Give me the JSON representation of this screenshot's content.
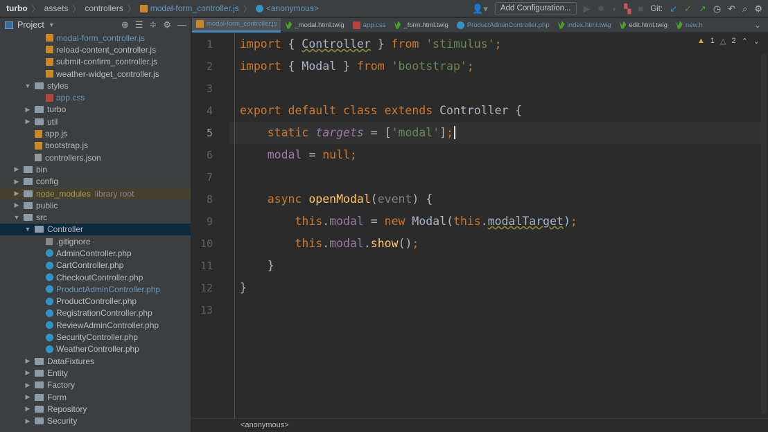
{
  "breadcrumb": [
    "turbo",
    "assets",
    "controllers",
    "modal-form_controller.js",
    "<anonymous>"
  ],
  "toolbar": {
    "add_configuration": "Add Configuration...",
    "git_label": "Git:"
  },
  "sidebar": {
    "title": "Project",
    "items": [
      {
        "label": "modal-form_controller.js",
        "level": 3,
        "type": "js",
        "color": "blue"
      },
      {
        "label": "reload-content_controller.js",
        "level": 3,
        "type": "js"
      },
      {
        "label": "submit-confirm_controller.js",
        "level": 3,
        "type": "js"
      },
      {
        "label": "weather-widget_controller.js",
        "level": 3,
        "type": "js"
      },
      {
        "label": "styles",
        "level": 2,
        "type": "folder",
        "open": true
      },
      {
        "label": "app.css",
        "level": 3,
        "type": "css",
        "color": "blue"
      },
      {
        "label": "turbo",
        "level": 2,
        "type": "folder"
      },
      {
        "label": "util",
        "level": 2,
        "type": "folder"
      },
      {
        "label": "app.js",
        "level": 2,
        "type": "js",
        "leaf": true
      },
      {
        "label": "bootstrap.js",
        "level": 2,
        "type": "js",
        "leaf": true
      },
      {
        "label": "controllers.json",
        "level": 2,
        "type": "json",
        "leaf": true
      },
      {
        "label": "bin",
        "level": 1,
        "type": "folder"
      },
      {
        "label": "config",
        "level": 1,
        "type": "folder"
      },
      {
        "label": "node_modules",
        "level": 1,
        "type": "folder",
        "color": "yel",
        "note": "library root"
      },
      {
        "label": "public",
        "level": 1,
        "type": "folder"
      },
      {
        "label": "src",
        "level": 1,
        "type": "folder",
        "open": true
      },
      {
        "label": "Controller",
        "level": 2,
        "type": "folder",
        "open": true,
        "selected": true
      },
      {
        "label": ".gitignore",
        "level": 3,
        "type": "git"
      },
      {
        "label": "AdminController.php",
        "level": 3,
        "type": "php"
      },
      {
        "label": "CartController.php",
        "level": 3,
        "type": "php"
      },
      {
        "label": "CheckoutController.php",
        "level": 3,
        "type": "php"
      },
      {
        "label": "ProductAdminController.php",
        "level": 3,
        "type": "php",
        "color": "blue"
      },
      {
        "label": "ProductController.php",
        "level": 3,
        "type": "php"
      },
      {
        "label": "RegistrationController.php",
        "level": 3,
        "type": "php"
      },
      {
        "label": "ReviewAdminController.php",
        "level": 3,
        "type": "php"
      },
      {
        "label": "SecurityController.php",
        "level": 3,
        "type": "php"
      },
      {
        "label": "WeatherController.php",
        "level": 3,
        "type": "php"
      },
      {
        "label": "DataFixtures",
        "level": 2,
        "type": "folder"
      },
      {
        "label": "Entity",
        "level": 2,
        "type": "folder"
      },
      {
        "label": "Factory",
        "level": 2,
        "type": "folder"
      },
      {
        "label": "Form",
        "level": 2,
        "type": "folder"
      },
      {
        "label": "Repository",
        "level": 2,
        "type": "folder"
      },
      {
        "label": "Security",
        "level": 2,
        "type": "folder"
      }
    ]
  },
  "tabs": [
    {
      "label": "modal-form_controller.js",
      "type": "js",
      "active": true
    },
    {
      "label": "_modal.html.twig",
      "type": "twig"
    },
    {
      "label": "app.css",
      "type": "css",
      "blue": true
    },
    {
      "label": "_form.html.twig",
      "type": "twig"
    },
    {
      "label": "ProductAdminController.php",
      "type": "php",
      "blue": true
    },
    {
      "label": "index.html.twig",
      "type": "twig",
      "blue": true
    },
    {
      "label": "edit.html.twig",
      "type": "twig"
    },
    {
      "label": "new.h",
      "type": "twig",
      "blue": true
    }
  ],
  "inspections": {
    "warnings": "1",
    "weak_warnings": "2"
  },
  "code": [
    [
      [
        "kw",
        "import "
      ],
      [
        "",
        "{ "
      ],
      [
        "ul",
        "Controller"
      ],
      [
        "",
        " } "
      ],
      [
        "kw",
        "from "
      ],
      [
        "str",
        "'stimulus'"
      ],
      [
        "kw",
        ";"
      ]
    ],
    [
      [
        "kw",
        "import "
      ],
      [
        "",
        "{ Modal } "
      ],
      [
        "kw",
        "from "
      ],
      [
        "str",
        "'bootstrap'"
      ],
      [
        "kw",
        ";"
      ]
    ],
    [],
    [
      [
        "kw",
        "export default class extends "
      ],
      [
        "",
        "Controller {"
      ]
    ],
    [
      [
        "",
        "    "
      ],
      [
        "kw",
        "static "
      ],
      [
        "propi",
        "targets"
      ],
      [
        "",
        " = ["
      ],
      [
        "str",
        "'modal'"
      ],
      [
        "",
        "]"
      ],
      [
        "kw",
        ";"
      ]
    ],
    [
      [
        "",
        "    "
      ],
      [
        "prop",
        "modal"
      ],
      [
        "",
        " = "
      ],
      [
        "kw",
        "null;"
      ]
    ],
    [],
    [
      [
        "",
        "    "
      ],
      [
        "kw",
        "async "
      ],
      [
        "fn",
        "openModal"
      ],
      [
        "",
        "("
      ],
      [
        "par",
        "event"
      ],
      [
        "",
        ") {"
      ]
    ],
    [
      [
        "",
        "        "
      ],
      [
        "kw",
        "this"
      ],
      [
        "",
        "."
      ],
      [
        "prop",
        "modal"
      ],
      [
        "",
        " = "
      ],
      [
        "kw",
        "new "
      ],
      [
        "",
        "Modal("
      ],
      [
        "kw",
        "this"
      ],
      [
        "",
        "."
      ],
      [
        "ul",
        "modalTarget"
      ],
      [
        "",
        ")"
      ],
      [
        "kw",
        ";"
      ]
    ],
    [
      [
        "",
        "        "
      ],
      [
        "kw",
        "this"
      ],
      [
        "",
        "."
      ],
      [
        "prop",
        "modal"
      ],
      [
        "",
        "."
      ],
      [
        "fn",
        "show"
      ],
      [
        "",
        "()"
      ],
      [
        "kw",
        ";"
      ]
    ],
    [
      [
        "",
        "    }"
      ]
    ],
    [
      [
        "",
        "}"
      ]
    ],
    []
  ],
  "current_line": 5,
  "status": {
    "context": "<anonymous>"
  }
}
